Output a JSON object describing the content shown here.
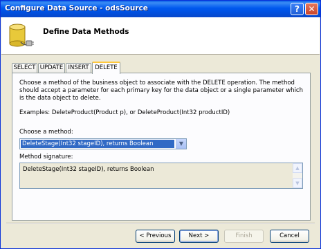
{
  "window": {
    "title": "Configure Data Source - odsSource"
  },
  "titlebar_buttons": {
    "help": "?",
    "close": "✕"
  },
  "header": {
    "heading": "Define Data Methods",
    "icon": "database-icon"
  },
  "tabs": [
    {
      "label": "SELECT"
    },
    {
      "label": "UPDATE"
    },
    {
      "label": "INSERT"
    },
    {
      "label": "DELETE",
      "active": true
    }
  ],
  "panel": {
    "description": "Choose a method of the business object to associate with the DELETE operation. The method should accept a parameter for each primary key for the data object or a single parameter which is the data object to delete.",
    "examples": "Examples: DeleteProduct(Product p), or DeleteProduct(Int32 productID)",
    "choose_label": "Choose a method:",
    "choose_value": "DeleteStage(Int32 stageID), returns Boolean",
    "signature_label": "Method signature:",
    "signature_value": "DeleteStage(Int32 stageID), returns Boolean"
  },
  "buttons": {
    "previous": "< Previous",
    "next": "Next >",
    "finish": "Finish",
    "cancel": "Cancel"
  },
  "colors": {
    "titlebar": "#0058ee",
    "selection": "#316ac5",
    "active_tab_accent": "#ffc83c"
  }
}
